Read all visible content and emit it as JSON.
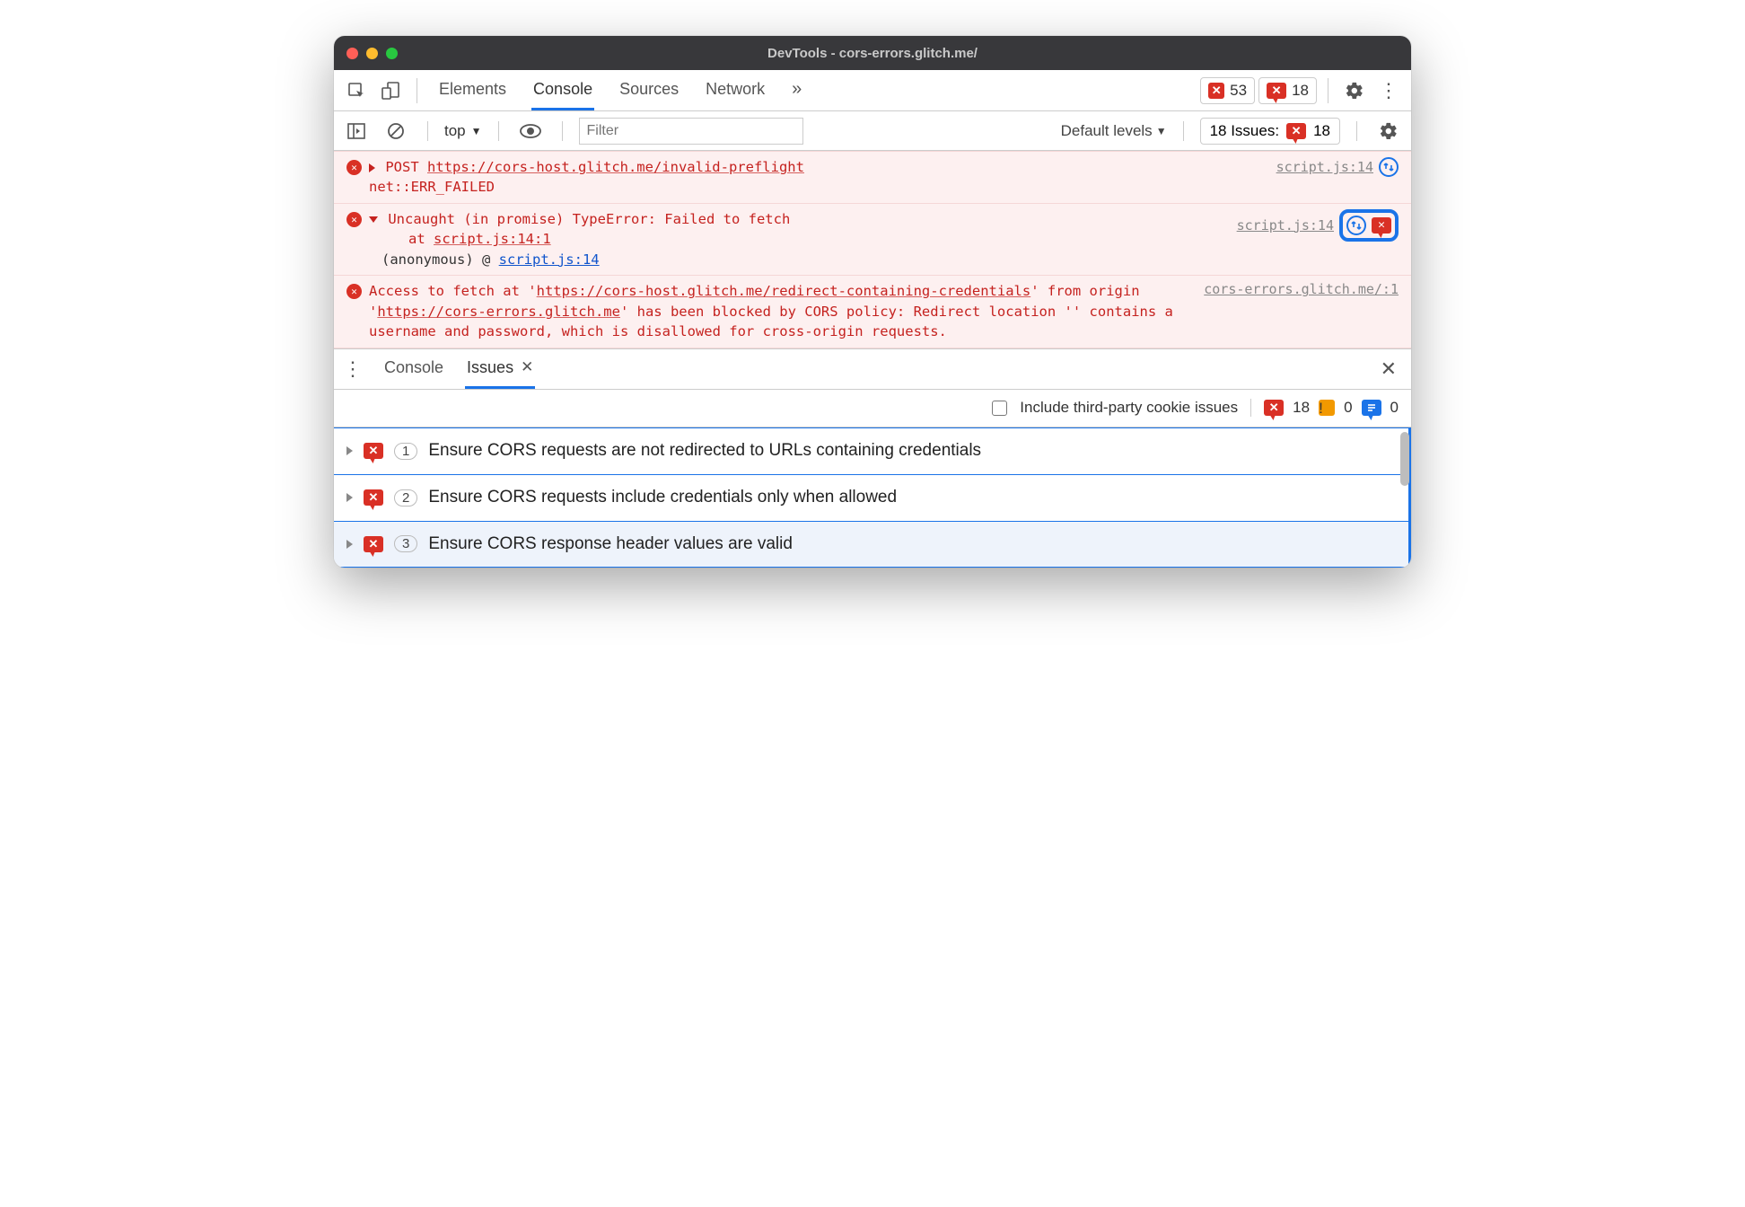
{
  "window": {
    "title": "DevTools - cors-errors.glitch.me/"
  },
  "main_tabs": {
    "items": [
      "Elements",
      "Console",
      "Sources",
      "Network"
    ],
    "active": "Console",
    "overflow": "»"
  },
  "counters": {
    "errors": "53",
    "issues": "18"
  },
  "sub_toolbar": {
    "context": "top",
    "filter_placeholder": "Filter",
    "levels": "Default levels",
    "issues_label": "18 Issues:",
    "issues_count": "18"
  },
  "console_msgs": [
    {
      "method": "POST",
      "url": "https://cors-host.glitch.me/invalid-preflight",
      "status": "net::ERR_FAILED",
      "source": "script.js:14"
    },
    {
      "title": "Uncaught (in promise) TypeError: Failed to fetch",
      "stack_at": "at ",
      "stack_link": "script.js:14:1",
      "anon": "(anonymous) @ ",
      "anon_link": "script.js:14",
      "source": "script.js:14"
    },
    {
      "pre1": "Access to fetch at '",
      "url1": "https://cors-host.glitch.me/redirect-containing-credentials",
      "mid1": "' from origin '",
      "url2": "https://cors-errors.glitch.me",
      "post1": "' has been blocked by CORS policy: Redirect location '' contains a username and password, which is disallowed for cross-origin requests.",
      "source": "cors-errors.glitch.me/:1"
    }
  ],
  "drawer": {
    "tabs": {
      "console": "Console",
      "issues": "Issues"
    },
    "include_3p": "Include third-party cookie issues",
    "counts": {
      "err": "18",
      "warn": "0",
      "info": "0"
    },
    "rows": [
      {
        "count": "1",
        "text": "Ensure CORS requests are not redirected to URLs containing credentials"
      },
      {
        "count": "2",
        "text": "Ensure CORS requests include credentials only when allowed"
      },
      {
        "count": "3",
        "text": "Ensure CORS response header values are valid"
      }
    ]
  }
}
